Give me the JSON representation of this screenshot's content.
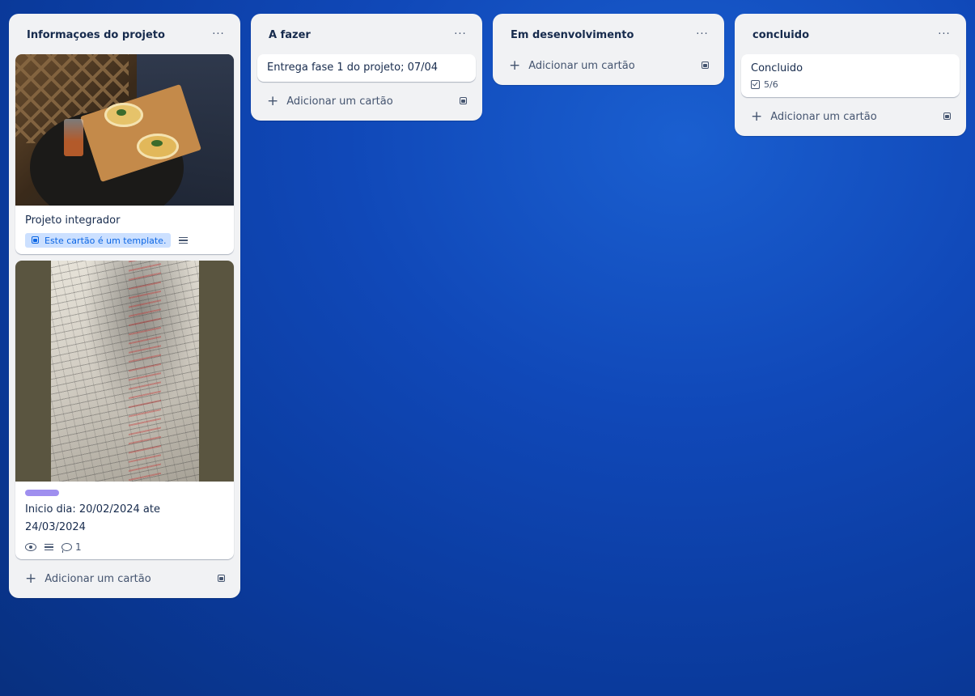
{
  "lists": [
    {
      "title": "Informaçoes do projeto",
      "more": "···",
      "cards": [
        {
          "title": "Projeto integrador",
          "template_badge": "Este cartão é um template."
        },
        {
          "title_line1": "Inicio dia: 20/02/2024 ate",
          "title_line2": "24/03/2024",
          "label_color": "#9f8fef",
          "comments": "1"
        }
      ],
      "add_label": "Adicionar um cartão"
    },
    {
      "title": "A fazer",
      "more": "···",
      "cards": [
        {
          "title": "Entrega fase 1 do projeto; 07/04"
        }
      ],
      "add_label": "Adicionar um cartão"
    },
    {
      "title": "Em desenvolvimento",
      "more": "···",
      "cards": [],
      "add_label": "Adicionar um cartão"
    },
    {
      "title": "concluido",
      "more": "···",
      "cards": [
        {
          "title": "Concluido",
          "checklist": "5/6"
        }
      ],
      "add_label": "Adicionar um cartão"
    }
  ],
  "colors": {
    "board_bg": "#0a3a9c",
    "list_bg": "#f1f2f4",
    "template_badge_bg": "#cce0ff",
    "template_badge_fg": "#0c66e4"
  }
}
